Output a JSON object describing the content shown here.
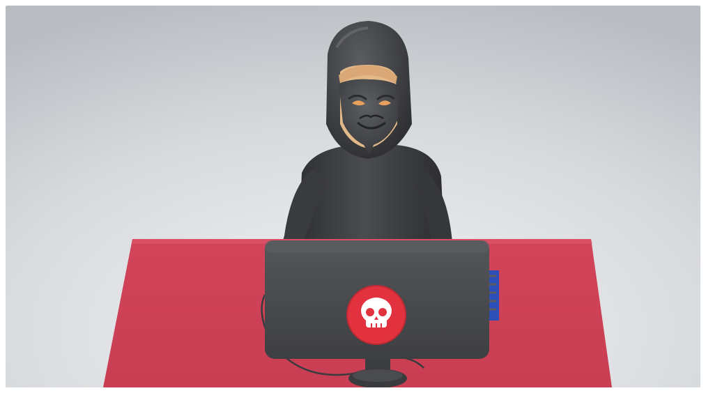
{
  "image": {
    "subject": "",
    "logo_icon": "skull-icon",
    "colors": {
      "background_light": "#eceef0",
      "background_mid": "#c9cdd1",
      "desk": "#d8485d",
      "desk_shadow": "#b8384c",
      "suit": "#3a3b3d",
      "suit_highlight": "#55575a",
      "skin": "#e3b98a",
      "laptop": "#4a4b4d",
      "logo_red": "#e2323f",
      "keyboard_blue": "#2c4fb8"
    }
  }
}
